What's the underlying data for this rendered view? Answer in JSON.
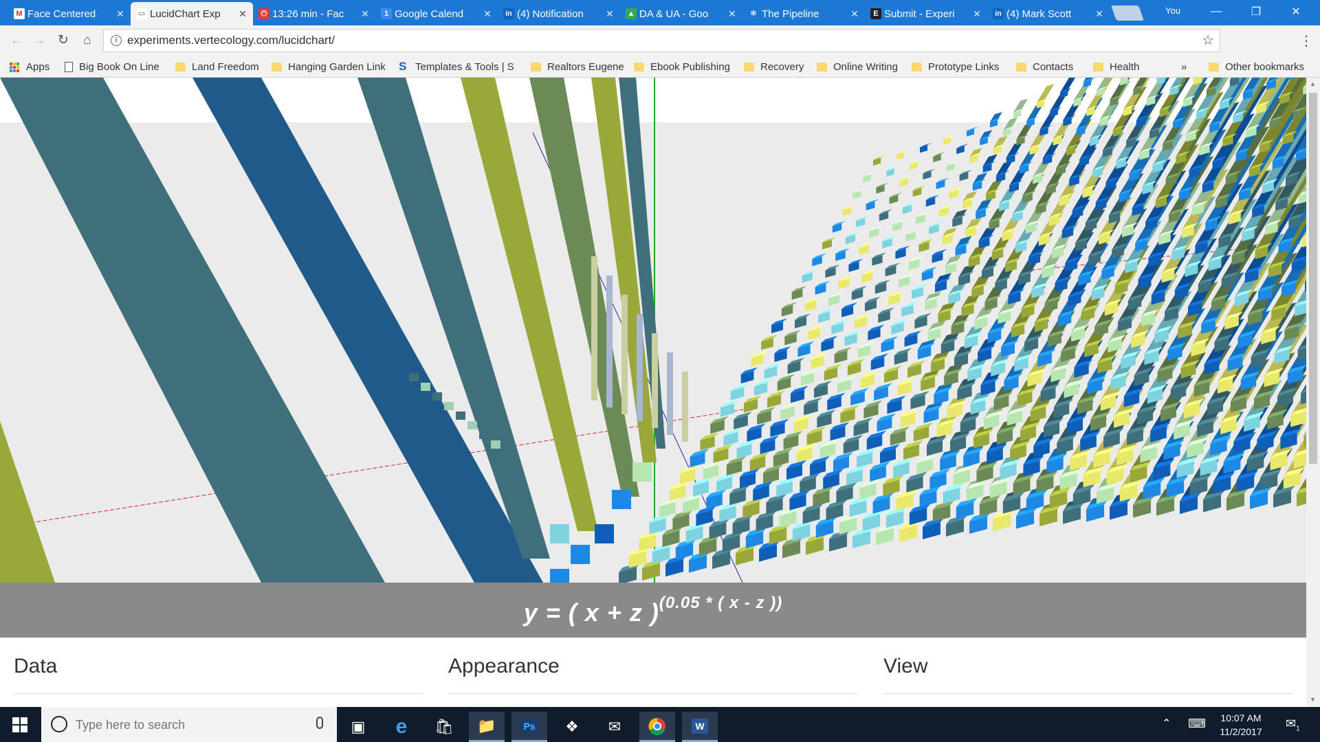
{
  "browser": {
    "tabs": [
      {
        "title": "Face Centered",
        "favicon": "gmail-icon",
        "color": "#ffffff",
        "fg": "#d93025",
        "glyph": "M"
      },
      {
        "title": "LucidChart Exp",
        "favicon": "page-icon",
        "color": "#ffffff",
        "fg": "#666666",
        "glyph": "▭",
        "active": true
      },
      {
        "title": "13:26 min - Fac",
        "favicon": "timer-icon",
        "color": "#e53935",
        "fg": "#ffffff",
        "glyph": "⏻"
      },
      {
        "title": "Google Calend",
        "favicon": "calendar-icon",
        "color": "#4285f4",
        "fg": "#ffffff",
        "glyph": "1"
      },
      {
        "title": "(4) Notification",
        "favicon": "linkedin-icon",
        "color": "#0a66c2",
        "fg": "#ffffff",
        "glyph": "in"
      },
      {
        "title": "DA & UA - Goo",
        "favicon": "drive-icon",
        "color": "#34a853",
        "fg": "#ffffff",
        "glyph": "▲"
      },
      {
        "title": "The Pipeline",
        "favicon": "gear-icon",
        "color": "#1c78d4",
        "fg": "#ffffff",
        "glyph": "✻"
      },
      {
        "title": "Submit - Experi",
        "favicon": "e-icon",
        "color": "#222222",
        "fg": "#ffffff",
        "glyph": "E"
      },
      {
        "title": "(4) Mark Scott",
        "favicon": "linkedin-icon",
        "color": "#0a66c2",
        "fg": "#ffffff",
        "glyph": "in"
      }
    ],
    "user_label": "You",
    "url": "experiments.vertecology.com/lucidchart/",
    "bookmarks": [
      {
        "label": "Apps",
        "kind": "apps"
      },
      {
        "label": "Big Book On Line",
        "kind": "page"
      },
      {
        "label": "Land Freedom",
        "kind": "folder"
      },
      {
        "label": "Hanging Garden Link",
        "kind": "folder"
      },
      {
        "label": "Templates & Tools | S",
        "kind": "s"
      },
      {
        "label": "Realtors Eugene",
        "kind": "folder"
      },
      {
        "label": "Ebook Publishing",
        "kind": "folder"
      },
      {
        "label": "Recovery",
        "kind": "folder"
      },
      {
        "label": "Online Writing",
        "kind": "folder"
      },
      {
        "label": "Prototype Links",
        "kind": "folder"
      },
      {
        "label": "Contacts",
        "kind": "folder"
      },
      {
        "label": "Health",
        "kind": "folder"
      }
    ],
    "overflow_label": "»",
    "other_bookmarks": "Other bookmarks"
  },
  "app": {
    "equation_main": "y = ( x + z )",
    "equation_exp": "(0.05 * ( x - z ))",
    "panels": [
      "Data",
      "Appearance",
      "View"
    ],
    "palette": [
      "#0f5fb8",
      "#1e88e5",
      "#7fd3e0",
      "#3f6f7a",
      "#9aa83a",
      "#e8e86a",
      "#b8e6b0",
      "#6b8a55"
    ]
  },
  "taskbar": {
    "search_placeholder": "Type here to search",
    "time": "10:07 AM",
    "date": "11/2/2017",
    "notification_count": "1"
  }
}
